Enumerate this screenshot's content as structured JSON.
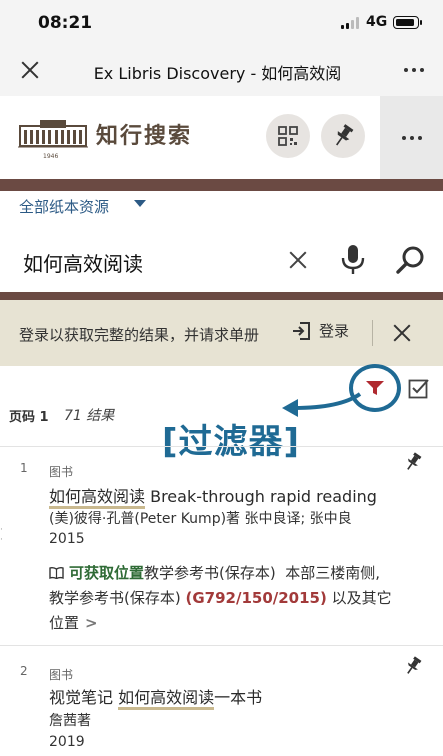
{
  "status": {
    "time": "08:21",
    "network": "4G"
  },
  "browser": {
    "title": "Ex Libris Discovery - 如何高效阅"
  },
  "header": {
    "logo_name": "知行搜索",
    "logo_year": "1946"
  },
  "search": {
    "scope": "全部纸本资源",
    "query": "如何高效阅读"
  },
  "banner": {
    "text": "登录以获取完整的结果，并请求单册",
    "login_label": "登录"
  },
  "results_bar": {
    "page_label": "页码 1",
    "count": "71 结果",
    "annotation": "[过滤器]"
  },
  "results": [
    {
      "number": "1",
      "type": "图书",
      "title_highlight": "如何高效阅读",
      "title_rest": " Break-through rapid reading",
      "author": "(美)彼得·孔普(Peter Kump)著 张中良译; 张中良",
      "year": "2015",
      "availability": {
        "status": "可获取位置",
        "location1": "教学参考书(保存本)",
        "place": "本部三楼南侧,",
        "location2": "教学参考书(保存本)",
        "call_number": "(G792/150/2015)",
        "suffix": "以及其它",
        "suffix2": "位置"
      }
    },
    {
      "number": "2",
      "type": "图书",
      "title_prefix": "视觉笔记 ",
      "title_highlight": "如何高效阅读",
      "title_rest": "一本书",
      "author": "詹茜著",
      "year": "2019"
    }
  ],
  "colors": {
    "brand_brown": "#6b4a43",
    "banner_bg": "#e7e3d3",
    "annotation_blue": "#1f6a94",
    "available_green": "#2f6b36",
    "call_number_red": "#a23a3a"
  }
}
